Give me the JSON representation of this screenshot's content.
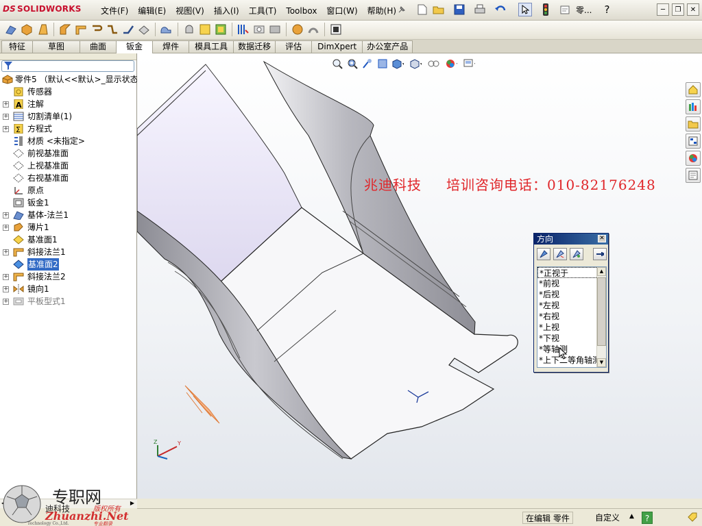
{
  "app": {
    "brand": "SOLIDWORKS",
    "brand_prefix": "DS",
    "accent": "#c8102e",
    "selection": "#316ac5"
  },
  "menu": {
    "items": [
      "文件(F)",
      "编辑(E)",
      "视图(V)",
      "插入(I)",
      "工具(T)",
      "Toolbox",
      "窗口(W)",
      "帮助(H)"
    ],
    "search_label": "零..."
  },
  "tabs": {
    "items": [
      "特征",
      "草图",
      "曲面",
      "钣金",
      "焊件",
      "模具工具",
      "数据迁移",
      "评估",
      "DimXpert",
      "办公室产品"
    ],
    "active": "钣金"
  },
  "tree": {
    "root": "零件5 （默认<<默认>_显示状态",
    "nodes": [
      {
        "label": "传感器",
        "expandable": false,
        "icon": "sensor-icon"
      },
      {
        "label": "注解",
        "expandable": true,
        "icon": "annotation-icon"
      },
      {
        "label": "切割清单(1)",
        "expandable": true,
        "icon": "cut-list-icon"
      },
      {
        "label": "方程式",
        "expandable": true,
        "icon": "equation-icon"
      },
      {
        "label": "材质 <未指定>",
        "expandable": false,
        "icon": "material-icon"
      },
      {
        "label": "前视基准面",
        "expandable": false,
        "icon": "plane-icon"
      },
      {
        "label": "上视基准面",
        "expandable": false,
        "icon": "plane-icon"
      },
      {
        "label": "右视基准面",
        "expandable": false,
        "icon": "plane-icon"
      },
      {
        "label": "原点",
        "expandable": false,
        "icon": "origin-icon"
      },
      {
        "label": "钣金1",
        "expandable": false,
        "icon": "sheet-metal-icon"
      },
      {
        "label": "基体-法兰1",
        "expandable": true,
        "icon": "base-flange-icon"
      },
      {
        "label": "薄片1",
        "expandable": true,
        "icon": "tab-feature-icon"
      },
      {
        "label": "基准面1",
        "expandable": false,
        "icon": "plane-icon"
      },
      {
        "label": "斜接法兰1",
        "expandable": true,
        "icon": "miter-flange-icon"
      },
      {
        "label": "基准面2",
        "expandable": false,
        "icon": "plane-icon",
        "selected": true
      },
      {
        "label": "斜接法兰2",
        "expandable": true,
        "icon": "miter-flange-icon"
      },
      {
        "label": "镜向1",
        "expandable": true,
        "icon": "mirror-icon"
      },
      {
        "label": "平板型式1",
        "expandable": true,
        "icon": "flat-pattern-icon",
        "suppressed": true
      }
    ]
  },
  "viewport": {
    "watermark_company": "兆迪科技",
    "watermark_phone": "培训咨询电话：010-82176248",
    "watermark_color": "#e0262a"
  },
  "orientation_dialog": {
    "title": "方向",
    "views": [
      "*正视于",
      "*前视",
      "*后视",
      "*左视",
      "*右视",
      "*上视",
      "*下视",
      "*等轴测",
      "*上下二等角轴测"
    ]
  },
  "status": {
    "editing": "在编辑 零件",
    "units": "自定义",
    "help": "?"
  },
  "logo_badge": {
    "line1": "专职网",
    "line2": "迪科技",
    "line3": "Zhuanzhi.Net",
    "line4": "Technology Co.,Ltd.",
    "line5": "版权所有",
    "line6": "专业翻录"
  }
}
